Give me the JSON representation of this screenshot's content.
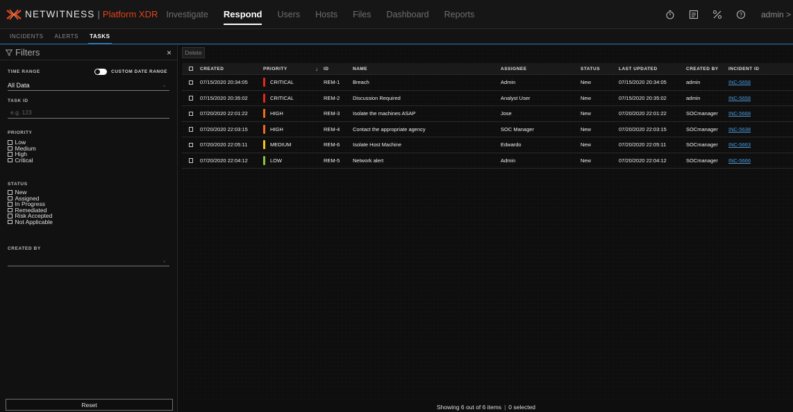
{
  "brand": {
    "name": "NETWITNESS",
    "separator": "|",
    "product": "Platform XDR",
    "accent": "#e0431d"
  },
  "nav": {
    "items": [
      {
        "label": "Investigate",
        "active": false
      },
      {
        "label": "Respond",
        "active": true
      },
      {
        "label": "Users",
        "active": false
      },
      {
        "label": "Hosts",
        "active": false
      },
      {
        "label": "Files",
        "active": false
      },
      {
        "label": "Dashboard",
        "active": false
      },
      {
        "label": "Reports",
        "active": false
      }
    ],
    "icons": [
      "stopwatch-icon",
      "reports-icon",
      "tools-icon",
      "help-icon"
    ],
    "user": "admin >"
  },
  "subtabs": [
    {
      "label": "INCIDENTS",
      "active": false
    },
    {
      "label": "ALERTS",
      "active": false
    },
    {
      "label": "TASKS",
      "active": true
    }
  ],
  "filters": {
    "title": "Filters",
    "close": "×",
    "time_range_label": "TIME RANGE",
    "custom_date_range_label": "CUSTOM DATE RANGE",
    "time_range_value": "All Data",
    "task_id_label": "TASK ID",
    "task_id_placeholder": "e.g. 123",
    "priority_label": "PRIORITY",
    "priority_options": [
      "Low",
      "Medium",
      "High",
      "Critical"
    ],
    "status_label": "STATUS",
    "status_options": [
      "New",
      "Assigned",
      "In Progress",
      "Remediated",
      "Risk Accepted",
      "Not Applicable"
    ],
    "created_by_label": "CREATED BY",
    "created_by_value": "",
    "reset_label": "Reset"
  },
  "toolbar": {
    "delete_label": "Delete"
  },
  "table": {
    "columns": [
      "CREATED",
      "PRIORITY",
      "ID",
      "NAME",
      "ASSIGNEE",
      "STATUS",
      "LAST UPDATED",
      "CREATED BY",
      "INCIDENT ID"
    ],
    "sort_indicator": "↓",
    "rows": [
      {
        "created": "07/15/2020 20:34:05",
        "priority": "CRITICAL",
        "priority_color": "#e8261a",
        "id": "REM-1",
        "name": "Breach",
        "assignee": "Admin",
        "status": "New",
        "updated": "07/15/2020 20:34:05",
        "created_by": "admin",
        "incident": "INC-5658"
      },
      {
        "created": "07/15/2020 20:35:02",
        "priority": "CRITICAL",
        "priority_color": "#e8261a",
        "id": "REM-2",
        "name": "Discussion Required",
        "assignee": "Analyst User",
        "status": "New",
        "updated": "07/15/2020 20:35:02",
        "created_by": "admin",
        "incident": "INC-5658"
      },
      {
        "created": "07/20/2020 22:01:22",
        "priority": "HIGH",
        "priority_color": "#f26a21",
        "id": "REM-3",
        "name": "Isolate the machines ASAP",
        "assignee": "Jose",
        "status": "New",
        "updated": "07/20/2020 22:01:22",
        "created_by": "SOCmanager",
        "incident": "INC-5668"
      },
      {
        "created": "07/20/2020 22:03:15",
        "priority": "HIGH",
        "priority_color": "#f26a21",
        "id": "REM-4",
        "name": "Contact the appropriate agency",
        "assignee": "SOC Manager",
        "status": "New",
        "updated": "07/20/2020 22:03:15",
        "created_by": "SOCmanager",
        "incident": "INC-5638"
      },
      {
        "created": "07/20/2020 22:05:11",
        "priority": "MEDIUM",
        "priority_color": "#f5c518",
        "id": "REM-6",
        "name": "Isolate Host Machine",
        "assignee": "Edwardo",
        "status": "New",
        "updated": "07/20/2020 22:05:11",
        "created_by": "SOCmanager",
        "incident": "INC-5663"
      },
      {
        "created": "07/20/2020 22:04:12",
        "priority": "LOW",
        "priority_color": "#8bc63f",
        "id": "REM-5",
        "name": "Network alert",
        "assignee": "Admin",
        "status": "New",
        "updated": "07/20/2020 22:04:12",
        "created_by": "SOCmanager",
        "incident": "INC-5666"
      }
    ]
  },
  "footer": {
    "showing": "Showing 6 out of 6 items",
    "separator": "|",
    "selected": "0 selected"
  }
}
